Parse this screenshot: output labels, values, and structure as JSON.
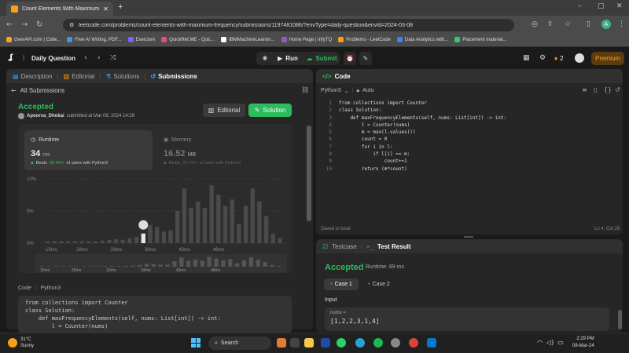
{
  "browser": {
    "tab_title": "Count Elements With Maximum",
    "new_tab": "+",
    "url": "leetcode.com/problems/count-elements-with-maximum-frequency/submissions/1197481086/?envType=daily-question&envId=2024-03-08",
    "profile_initial": "A"
  },
  "bookmarks": [
    {
      "label": "OverAPI.com | Colle...",
      "color": "#f5a623"
    },
    {
      "label": "Free AI Writing, PDF...",
      "color": "#4a90e2"
    },
    {
      "label": "Exercism",
      "color": "#7b61ff"
    },
    {
      "label": "QuickRef.ME - Quic...",
      "color": "#e94e77"
    },
    {
      "label": "IBMMachineLearnin...",
      "color": "#ffffff"
    },
    {
      "label": "Home Page | InfyTQ",
      "color": "#9b59b6"
    },
    {
      "label": "Problems - LeetCode",
      "color": "#f89f1b"
    },
    {
      "label": "Data Analytics with...",
      "color": "#3b82f6"
    },
    {
      "label": "Placement material...",
      "color": "#2ecc71"
    }
  ],
  "header": {
    "title": "Daily Question",
    "run": "Run",
    "submit": "Submit",
    "streak": "2",
    "premium": "Premium"
  },
  "left_tabs": [
    "Description",
    "Editorial",
    "Solutions",
    "Submissions"
  ],
  "submission": {
    "back": "All Submissions",
    "status": "Accepted",
    "user": "Apoorva_Dhokai",
    "submitted": "submitted at Mar 08, 2024 14:29",
    "editorial_btn": "Editorial",
    "solution_btn": "Solution"
  },
  "runtime": {
    "label": "Runtime",
    "value": "34",
    "unit": "ms",
    "beats_pre": "Beats",
    "beats_pct": "96.46%",
    "beats_post": "of users with Python3"
  },
  "memory": {
    "label": "Memory",
    "value": "16.52",
    "unit": "MB",
    "beats_pre": "Beats",
    "beats_pct": "93.74%",
    "beats_post": "of users with Python3"
  },
  "chart_data": {
    "type": "bar",
    "yticks": [
      "10%",
      "5%",
      "0%"
    ],
    "ylim": [
      0,
      10
    ],
    "xtick_labels": [
      "15ms",
      "28ms",
      "33ms",
      "38ms",
      "43ms",
      "48ms"
    ],
    "values": [
      0.3,
      0.3,
      0.3,
      0.3,
      0.3,
      0.3,
      0.3,
      0.3,
      0.4,
      0.5,
      0.6,
      0.5,
      0.8,
      1,
      1.5,
      2.8,
      2.5,
      1.8,
      2,
      5,
      8.5,
      5.5,
      6.5,
      5.5,
      9,
      7.5,
      5.8,
      6.8,
      3,
      5.8,
      8.5,
      6.5,
      4.2,
      1.5,
      0.8
    ],
    "highlight_index": 14,
    "minimap_xtick_labels": [
      "15ms",
      "28ms",
      "33ms",
      "38ms",
      "43ms",
      "48ms"
    ]
  },
  "code_section": {
    "label": "Code",
    "lang": "Python3",
    "lines": [
      "from collections import Counter",
      "class Solution:",
      "    def maxFrequencyElements(self, nums: List[int]) -> int:",
      "        l = Counter(nums)"
    ]
  },
  "editor": {
    "title": "Code",
    "lang": "Python3",
    "mode": "Auto",
    "lines": [
      "from collections import Counter",
      "class Solution:",
      "    def maxFrequencyElements(self, nums: List[int]) -> int:",
      "        l = Counter(nums)",
      "        m = max(l.values())",
      "        count = 0",
      "        for i in l:",
      "            if l[i] == m:",
      "                count+=1",
      "        return (m*count)"
    ],
    "saved": "Saved to local",
    "cursor": "Ln 4, Col 26"
  },
  "test": {
    "tab1": "Testcase",
    "tab2": "Test Result",
    "status": "Accepted",
    "runtime": "Runtime: 89 ms",
    "case1": "Case 1",
    "case2": "Case 2",
    "input_label": "Input",
    "input_name": "nums =",
    "input_value": "[1,2,2,3,1,4]"
  },
  "taskbar": {
    "temp": "31°C",
    "weather": "Sunny",
    "search": "Search",
    "time": "2:29 PM",
    "date": "08-Mar-24",
    "lang": "ENG IN"
  },
  "colors": {
    "accent_green": "#2cbb5d",
    "orange": "#ffa116"
  }
}
